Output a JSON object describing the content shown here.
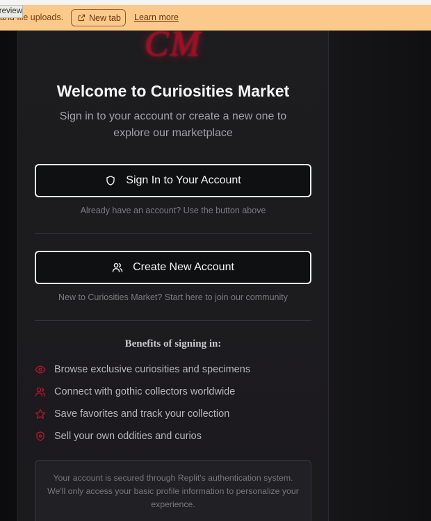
{
  "banner": {
    "text": "and file uploads.",
    "new_tab_label": "New tab",
    "learn_more_label": "Learn more",
    "preview_tag": "Preview"
  },
  "logo": {
    "text": "CM"
  },
  "header": {
    "title": "Welcome to Curiosities Market",
    "subtitle": "Sign in to your account or create a new one to explore our marketplace"
  },
  "actions": {
    "sign_in_label": "Sign In to Your Account",
    "sign_in_hint": "Already have an account? Use the button above",
    "create_label": "Create New Account",
    "create_hint": "New to Curiosities Market? Start here to join our community"
  },
  "benefits": {
    "title": "Benefits of signing in:",
    "items": [
      {
        "icon": "eye-icon",
        "label": "Browse exclusive curiosities and specimens"
      },
      {
        "icon": "users-icon",
        "label": "Connect with gothic collectors worldwide"
      },
      {
        "icon": "star-icon",
        "label": "Save favorites and track your collection"
      },
      {
        "icon": "shield-icon",
        "label": "Sell your own oddities and curios"
      }
    ]
  },
  "notice": {
    "text": "Your account is secured through Replit's authentication system. We'll only access your basic profile information to personalize your experience."
  },
  "colors": {
    "accent": "#9c0f24",
    "banner_bg": "#fcc98c",
    "button_bg": "#0f1011",
    "card_bg": "#1d1c1f"
  }
}
